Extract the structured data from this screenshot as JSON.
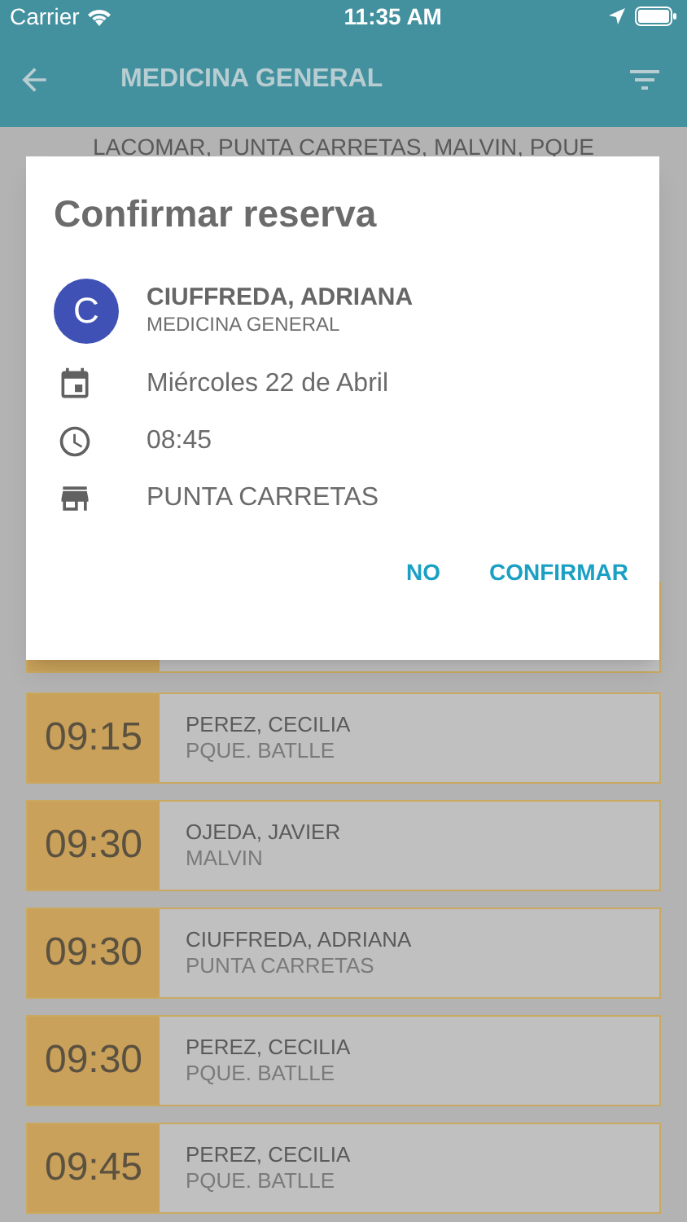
{
  "status_bar": {
    "carrier": "Carrier",
    "time": "11:35 AM"
  },
  "header": {
    "title": "MEDICINA GENERAL"
  },
  "filter_text": "LACOMAR, PUNTA CARRETAS, MALVIN, PQUE",
  "dialog": {
    "title": "Confirmar reserva",
    "avatar_letter": "C",
    "name": "CIUFFREDA, ADRIANA",
    "specialty": "MEDICINA GENERAL",
    "details": [
      {
        "kind": "date",
        "text": "Miércoles 22 de Abril"
      },
      {
        "kind": "time",
        "text": "08:45"
      },
      {
        "kind": "place",
        "text": "PUNTA CARRETAS"
      }
    ],
    "buttons": [
      "NO",
      "CONFIRMAR"
    ]
  },
  "slots": [
    {
      "time": "09:15",
      "name": "PEREZ, CECILIA",
      "location": "PQUE. BATLLE"
    },
    {
      "time": "09:30",
      "name": "OJEDA, JAVIER",
      "location": "MALVIN"
    },
    {
      "time": "09:30",
      "name": "CIUFFREDA, ADRIANA",
      "location": "PUNTA CARRETAS"
    },
    {
      "time": "09:30",
      "name": "PEREZ, CECILIA",
      "location": "PQUE. BATLLE"
    },
    {
      "time": "09:45",
      "name": "PEREZ, CECILIA",
      "location": "PQUE. BATLLE"
    }
  ]
}
